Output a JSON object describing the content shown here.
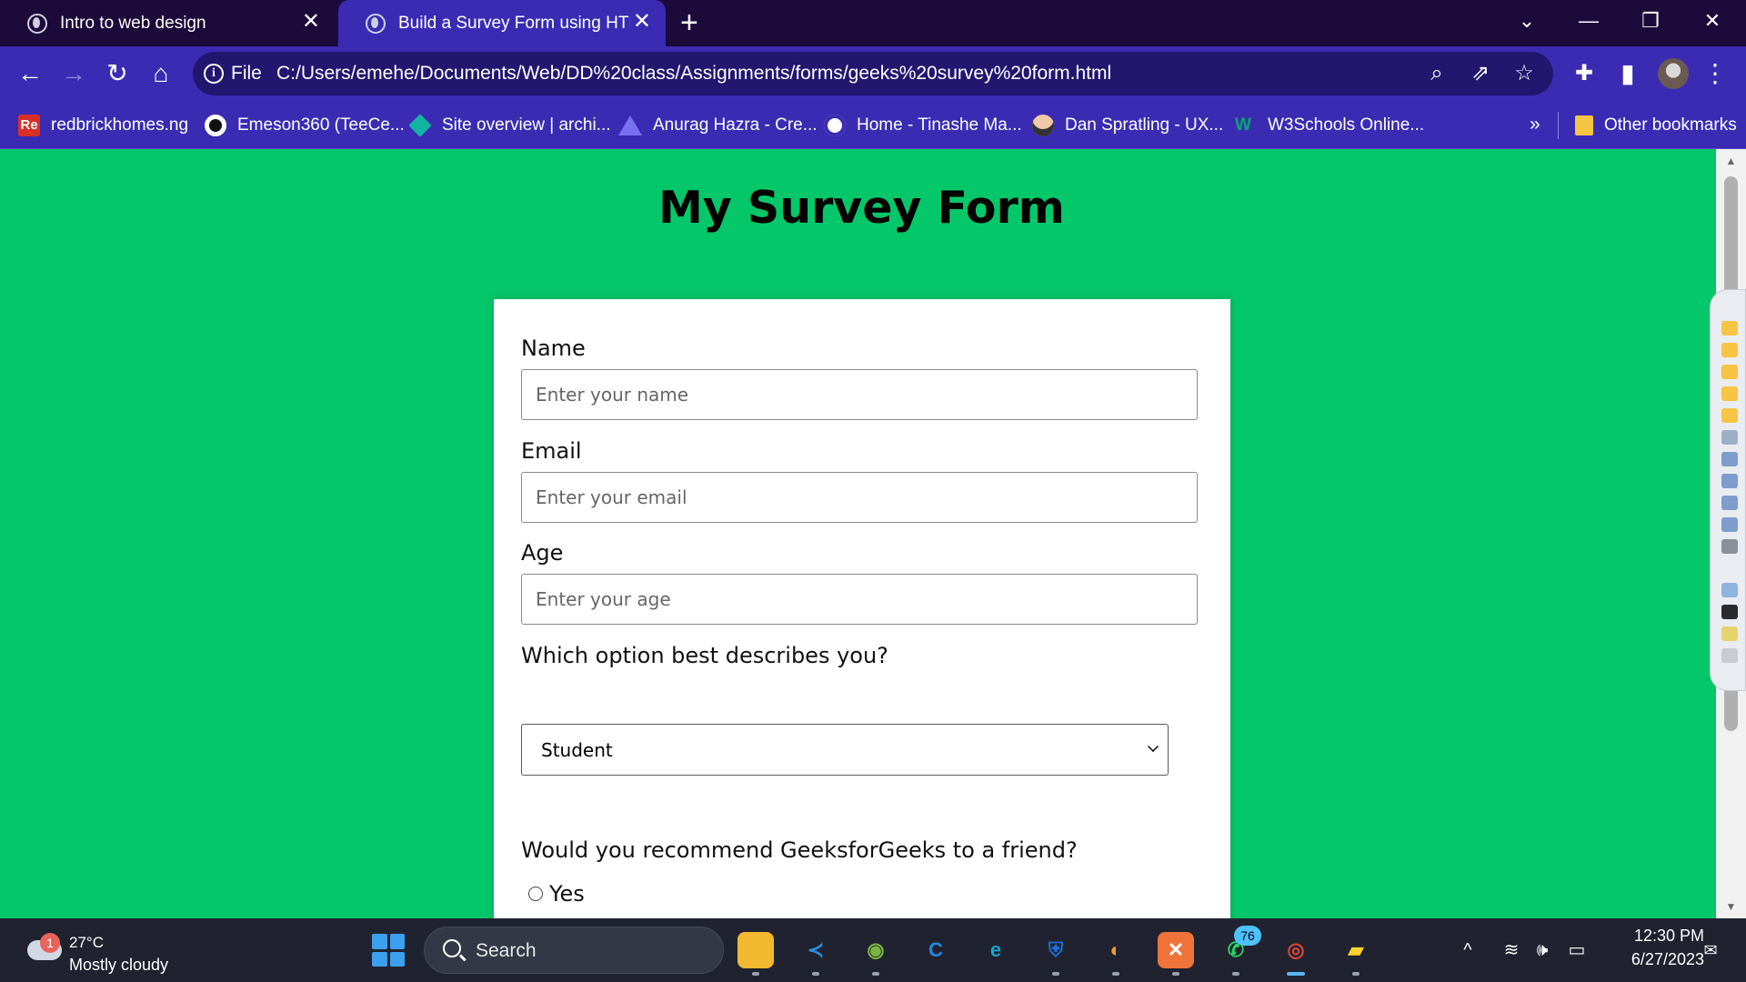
{
  "browser": {
    "tabs": [
      {
        "title": "Intro to web design",
        "close": "✕",
        "active": false
      },
      {
        "title": "Build a Survey Form using HTML",
        "close": "✕",
        "active": true
      }
    ],
    "new_tab": "+",
    "window_controls": {
      "tab_search": "⌄",
      "minimize": "—",
      "restore": "❐",
      "close": "✕"
    },
    "nav": {
      "back": "←",
      "forward": "→",
      "reload": "↻",
      "home": "⌂"
    },
    "omnibox": {
      "site_info_label": "File",
      "url": "C:/Users/emehe/Documents/Web/DD%20class/Assignments/forms/geeks%20survey%20form.html",
      "icons": [
        "zoom-icon",
        "share-icon",
        "bookmark-star-icon"
      ]
    },
    "toolbar_icons": [
      "extensions-icon",
      "side-panel-icon",
      "profile-avatar-icon",
      "menu-icon"
    ],
    "bookmarks": [
      {
        "label": "redbrickhomes.ng",
        "icon": "Re"
      },
      {
        "label": "Emeson360 (TeeCe...",
        "icon": "github-icon"
      },
      {
        "label": "Site overview | archi...",
        "icon": "diamond-icon"
      },
      {
        "label": "Anurag Hazra - Cre...",
        "icon": "triangle-icon"
      },
      {
        "label": "Home - Tinashe Ma...",
        "icon": "globe-icon"
      },
      {
        "label": "Dan Spratling - UX...",
        "icon": "face-icon"
      },
      {
        "label": "W3Schools Online...",
        "icon": "w3schools-icon"
      }
    ],
    "bookmarks_overflow": "»",
    "other_bookmarks": "Other bookmarks"
  },
  "page": {
    "title": "My Survey Form",
    "form": {
      "name_label": "Name",
      "name_placeholder": "Enter your name",
      "email_label": "Email",
      "email_placeholder": "Enter your email",
      "age_label": "Age",
      "age_placeholder": "Enter your age",
      "role_label": "Which option best describes you?",
      "role_selected": "Student",
      "recommend_label": "Would you recommend GeeksforGeeks to a friend?",
      "recommend_option_yes": "Yes"
    }
  },
  "scrollbar": {
    "up": "▲",
    "down": "▼"
  },
  "taskbar": {
    "weather": {
      "badge": "1",
      "temperature": "27°C",
      "condition": "Mostly cloudy"
    },
    "search_label": "Search",
    "apps": [
      {
        "name": "file-explorer",
        "glyph": "",
        "color": "#f2b830"
      },
      {
        "name": "vscode",
        "glyph": "≺",
        "color": "#2a8fe0"
      },
      {
        "name": "app-chameleon",
        "glyph": "◉",
        "color": "#7cb342"
      },
      {
        "name": "app-c",
        "glyph": "C",
        "color": "#1e88e5"
      },
      {
        "name": "edge",
        "glyph": "e",
        "color": "#1aa3c8"
      },
      {
        "name": "defender",
        "glyph": "⛨",
        "color": "#1e6fd8"
      },
      {
        "name": "app-orange",
        "glyph": "◐",
        "color": "#f29b2c"
      },
      {
        "name": "xampp",
        "glyph": "✕",
        "color": "#f0733b"
      },
      {
        "name": "whatsapp",
        "glyph": "✆",
        "color": "#25d366"
      },
      {
        "name": "chrome",
        "glyph": "◎",
        "color": "#d9453b"
      },
      {
        "name": "sticky-notes",
        "glyph": "▰",
        "color": "#f8d32c"
      }
    ],
    "whatsapp_badge": "76",
    "tray": {
      "chevron": "^",
      "wifi": "≋",
      "volume": "🕪",
      "battery": "▭"
    },
    "clock": {
      "time": "12:30 PM",
      "date": "6/27/2023"
    },
    "notifications": "✉"
  },
  "colors": {
    "page_background": "#04c76a",
    "browser_frame": "#3b2bb3",
    "tab_strip": "#1b0a3a",
    "taskbar": "#20232f"
  }
}
